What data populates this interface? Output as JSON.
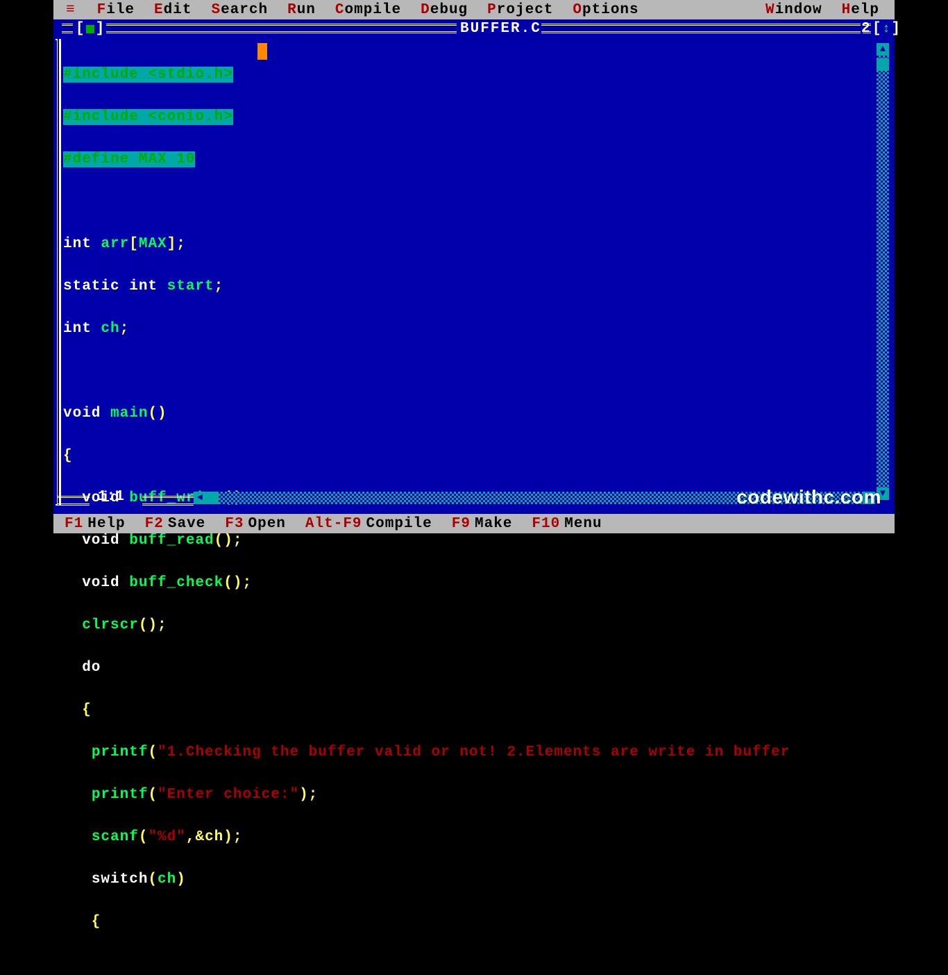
{
  "menu": {
    "items": [
      {
        "hk": "F",
        "rest": "ile"
      },
      {
        "hk": "E",
        "rest": "dit"
      },
      {
        "hk": "S",
        "rest": "earch"
      },
      {
        "hk": "R",
        "rest": "un"
      },
      {
        "hk": "C",
        "rest": "ompile"
      },
      {
        "hk": "D",
        "rest": "ebug"
      },
      {
        "hk": "P",
        "rest": "roject"
      },
      {
        "hk": "O",
        "rest": "ptions"
      },
      {
        "hk": "W",
        "rest": "indow"
      },
      {
        "hk": "H",
        "rest": "elp"
      }
    ]
  },
  "window": {
    "title": "BUFFER.C",
    "number": "2",
    "cursor_pos": "1:1"
  },
  "code": {
    "l1_a": "#include <stdio.h>",
    "l2_a": "#include <conio.h>",
    "l3_a": "#define MAX 10",
    "l5_int": "int ",
    "l5_arr": "arr",
    "l5_b": "[",
    "l5_max": "MAX",
    "l5_c": "];",
    "l6_a": "static int ",
    "l6_b": "start",
    "l6_c": ";",
    "l7_a": "int ",
    "l7_b": "ch",
    "l7_c": ";",
    "l9_a": "void ",
    "l9_b": "main",
    "l9_c": "()",
    "l10": "{",
    "l11_a": "  void ",
    "l11_b": "buff_write",
    "l11_c": "();",
    "l12_a": "  void ",
    "l12_b": "buff_read",
    "l12_c": "();",
    "l13_a": "  void ",
    "l13_b": "buff_check",
    "l13_c": "();",
    "l14_a": "  ",
    "l14_b": "clrscr",
    "l14_c": "();",
    "l15": "  do",
    "l16": "  {",
    "l17_a": "   ",
    "l17_b": "printf",
    "l17_c": "(",
    "l17_d": "\"1.Checking the buffer valid or not! 2.Elements are write in buffer",
    "l18_a": "   ",
    "l18_b": "printf",
    "l18_c": "(",
    "l18_d": "\"Enter choice:\"",
    "l18_e": ");",
    "l19_a": "   ",
    "l19_b": "scanf",
    "l19_c": "(",
    "l19_d": "\"%d\"",
    "l19_e": ",&ch);",
    "l20_a": "   ",
    "l20_b": "switch",
    "l20_c": "(",
    "l20_d": "ch",
    "l20_e": ")",
    "l21": "   {"
  },
  "statusbar": {
    "items": [
      {
        "k": "F1",
        "l": "Help"
      },
      {
        "k": "F2",
        "l": "Save"
      },
      {
        "k": "F3",
        "l": "Open"
      },
      {
        "k": "Alt-F9",
        "l": "Compile"
      },
      {
        "k": "F9",
        "l": "Make"
      },
      {
        "k": "F10",
        "l": "Menu"
      }
    ]
  },
  "watermark": "codewithc.com"
}
